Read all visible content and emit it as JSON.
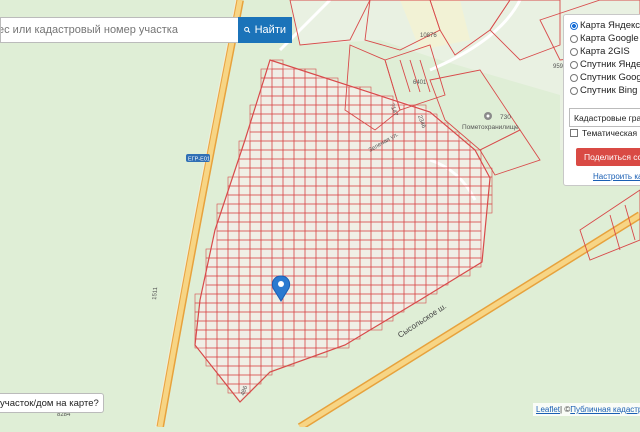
{
  "search": {
    "placeholder": "ес или кадастровый номер участка",
    "button_label": "Найти"
  },
  "layers": {
    "options": [
      {
        "label": "Карта Яндекс",
        "selected": true
      },
      {
        "label": "Карта Google",
        "selected": false
      },
      {
        "label": "Карта 2GIS",
        "selected": false
      },
      {
        "label": "Спутник Яндекс",
        "selected": false
      },
      {
        "label": "Спутник Google",
        "selected": false
      },
      {
        "label": "Спутник Bing",
        "selected": false
      }
    ],
    "overlay_select": "Кадастровые границы",
    "thematic_checkbox": "Тематическая карта",
    "share_button": "Поделиться ссылкой",
    "config_link": "Настроить карту"
  },
  "bottom_prompt": "участок/дом на карте?",
  "attribution": {
    "leaflet": "Leaflet",
    "separator": " | © ",
    "source": "Публичная кадастровая карта"
  },
  "map_labels": {
    "road_badge": "ЕГР-Е01",
    "road_number": "1511",
    "street_1": "Зеленая ул.",
    "street_2": "Сысольское ш.",
    "poi_number": "730",
    "poi_name": "Пометохранилище",
    "parcel_6401": "6401",
    "parcel_10876": "10876",
    "parcel_7147": "7147",
    "parcel_2346": "2346",
    "parcel_959": "959",
    "parcel_8284": "8284",
    "parcel_486": "486"
  },
  "colors": {
    "map_background": "#dfeed6",
    "cadastre_line": "#d84a4a",
    "search_button": "#1b73b9",
    "share_button": "#d94a44",
    "marker": "#2a7ad0"
  }
}
